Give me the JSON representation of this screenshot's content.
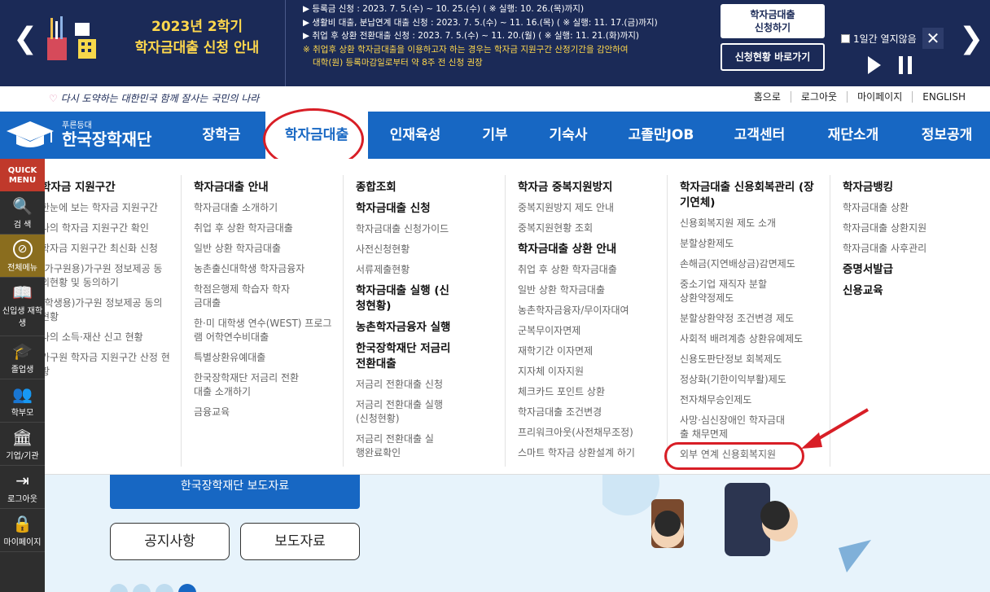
{
  "banner": {
    "title_line1": "2023년 2학기",
    "title_line2": "학자금대출 신청 안내",
    "notices": [
      "▶ 등록금 신청 : 2023. 7. 5.(수) ~ 10. 25.(수) ( ※ 실행: 10. 26.(목)까지)",
      "▶ 생활비 대출, 분납연계 대출 신청 : 2023. 7. 5.(수) ~ 11. 16.(목) ( ※ 실행: 11. 17.(금)까지)",
      "▶ 취업 후 상환 전환대출 신청 : 2023. 7. 5.(수) ~ 11. 20.(월) ( ※ 실행: 11. 21.(화)까지)"
    ],
    "warn_line1": "※ 취업후 상환 학자금대출을 이용하고자 하는 경우는 학자금 지원구간 산정기간을 감안하여",
    "warn_line2": "대학(원) 등록마감일로부터 약 8주 전 신청 권장",
    "btn_apply_line1": "학자금대출",
    "btn_apply_line2": "신청하기",
    "btn_status": "신청현황 바로가기",
    "daily_label": "1일간 열지않음",
    "close": "✕",
    "prev": "❮",
    "next": "❯"
  },
  "slogan": "다시 도약하는 대한민국  함께 잘사는 국민의 나라",
  "util": [
    "홈으로",
    "로그아웃",
    "마이페이지",
    "ENGLISH"
  ],
  "logo": {
    "sub": "푸른등대",
    "name": "한국장학재단"
  },
  "gnb": [
    "장학금",
    "학자금대출",
    "인재육성",
    "기부",
    "기숙사",
    "고졸만JOB",
    "고객센터",
    "재단소개",
    "정보공개"
  ],
  "quick": {
    "title": "QUICK MENU",
    "items": [
      "검 색",
      "전체메뉴",
      "신입생 재학생",
      "졸업생",
      "학부모",
      "기업/기관",
      "로그아웃",
      "마이페이지"
    ],
    "icons": [
      "🔍",
      "⊘",
      "📖",
      "🎓",
      "👥",
      "🏛",
      "⇥",
      "🔒"
    ]
  },
  "menu": {
    "col1": {
      "head": "학자금 지원구간",
      "subs": [
        "한눈에 보는 학자금 지원구간",
        "나의 학자금 지원구간 확인",
        "학자금 지원구간 최신화 신청",
        "(가구원용)가구원 정보제공 동의현황 및 동의하기",
        "(학생용)가구원 정보제공 동의현황",
        "나의 소득·재산 신고 현황",
        "가구원 학자금 지원구간 산정 현황"
      ]
    },
    "col2": {
      "head": "학자금대출 안내",
      "subs": [
        "학자금대출 소개하기",
        "취업 후 상환 학자금대출",
        "일반 상환 학자금대출",
        "농촌출신대학생 학자금융자",
        "학점은행제 학습자 학자금대출",
        "한·미 대학생 연수(WEST) 프로그램 어학연수비대출",
        "특별상환유예대출",
        "한국장학재단 저금리 전환대출 소개하기",
        "금융교육"
      ]
    },
    "col3": {
      "groups": [
        {
          "head": "종합조회",
          "subs": []
        },
        {
          "head": "학자금대출 신청",
          "subs": [
            "학자금대출 신청가이드",
            "사전신청현황",
            "서류제출현황"
          ]
        },
        {
          "head": "학자금대출 실행 (신청현황)",
          "subs": []
        },
        {
          "head": "농촌학자금융자 실행",
          "subs": []
        },
        {
          "head": "한국장학재단 저금리 전환대출",
          "subs": [
            "저금리 전환대출 신청",
            "저금리 전환대출 실행 (신청현황)",
            "저금리 전환대출 실행완료확인"
          ]
        }
      ]
    },
    "col4": {
      "groups": [
        {
          "head": "학자금 중복지원방지",
          "subs": [
            "중복지원방지 제도 안내",
            "중복지원현황 조회"
          ]
        },
        {
          "head": "학자금대출 상환 안내",
          "subs": [
            "취업 후 상환 학자금대출",
            "일반 상환 학자금대출",
            "농촌학자금융자/무이자대여",
            "군복무이자면제",
            "재학기간 이자면제",
            "지자체 이자지원",
            "체크카드 포인트 상환",
            "학자금대출 조건변경",
            "프리워크아웃(사전채무조정)",
            "스마트 학자금 상환설계 하기"
          ]
        }
      ]
    },
    "col5": {
      "head": "학자금대출 신용회복관리 (장기연체)",
      "subs": [
        "신용회복지원 제도 소개",
        "분할상환제도",
        "손해금(지연배상금)감면제도",
        "중소기업 재직자 분할상환약정제도",
        "분할상환약정 조건변경 제도",
        "사회적 배려계층 상환유예제도",
        "신용도판단정보 회복제도",
        "정상화(기한이익부활)제도",
        "전자채무승인제도",
        "사망·심신장애인 학자금대출 채무면제",
        "외부 연계 신용회복지원"
      ]
    },
    "col6": {
      "groups": [
        {
          "head": "학자금뱅킹",
          "subs": [
            "학자금대출 상환",
            "학자금대출 상환지원",
            "학자금대출 사후관리"
          ]
        },
        {
          "head": "증명서발급",
          "subs": []
        },
        {
          "head": "신용교육",
          "subs": []
        }
      ]
    }
  },
  "lower": {
    "blue_btn": "한국장학재단 보도자료",
    "btn_notice": "공지사항",
    "btn_press": "보도자료"
  },
  "colors": {
    "navy": "#1b2a57",
    "blue": "#1767c3",
    "yellow": "#ffd84d",
    "red": "#d81e26"
  }
}
